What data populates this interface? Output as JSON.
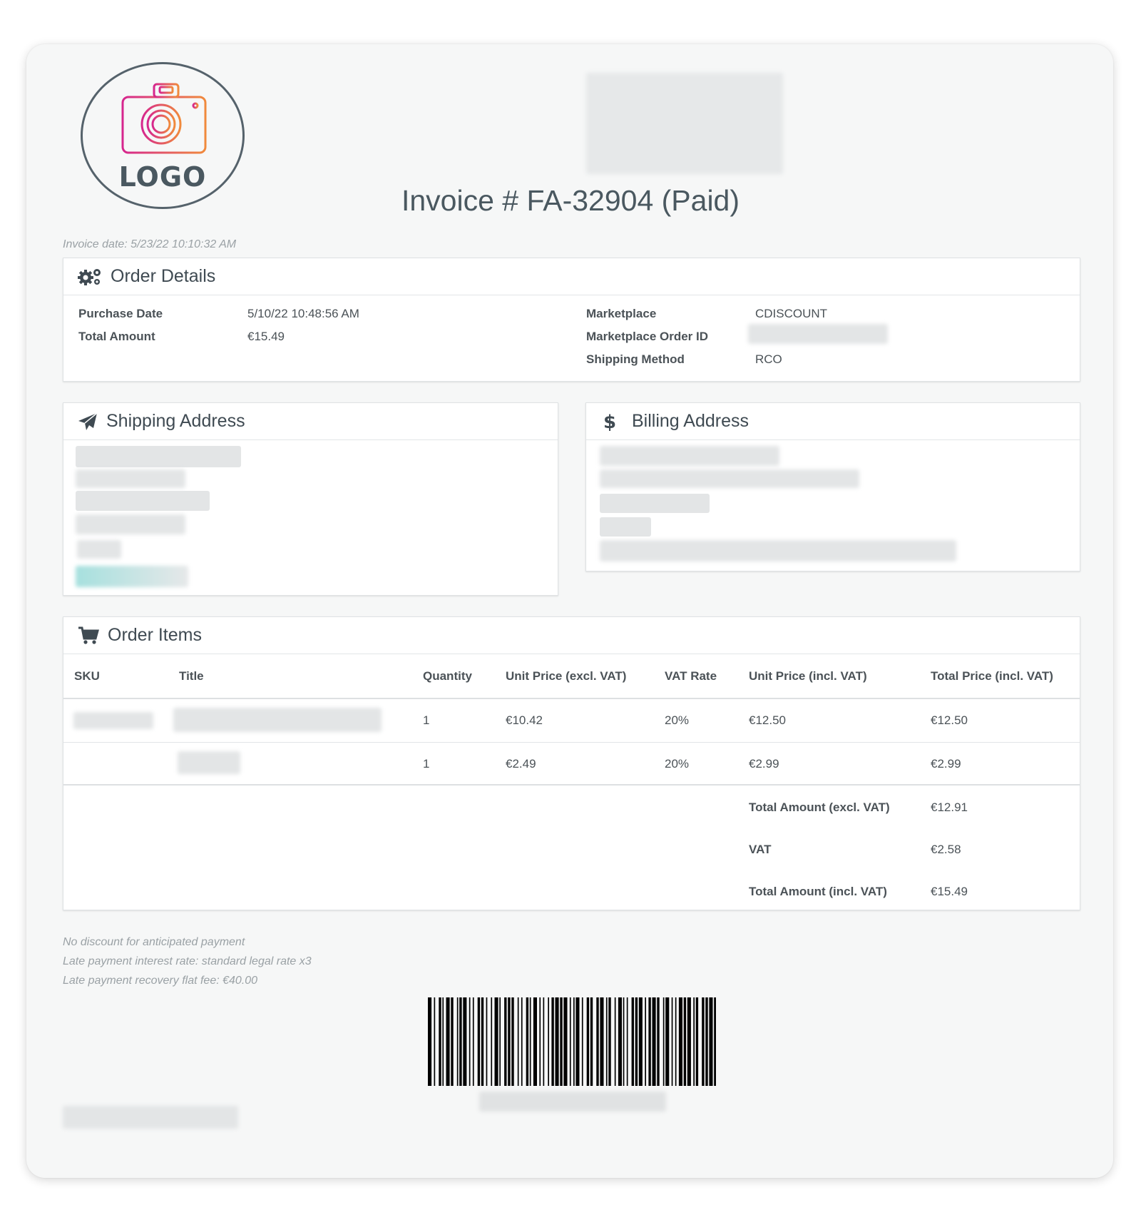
{
  "logo": {
    "text": "LOGO"
  },
  "invoice": {
    "title": "Invoice # FA-32904 (Paid)",
    "date": "Invoice date: 5/23/22 10:10:32 AM"
  },
  "order_details": {
    "heading": "Order Details",
    "purchase_date_label": "Purchase Date",
    "purchase_date": "5/10/22 10:48:56 AM",
    "total_amount_label": "Total Amount",
    "total_amount": "€15.49",
    "marketplace_label": "Marketplace",
    "marketplace": "CDISCOUNT",
    "marketplace_order_id_label": "Marketplace Order ID",
    "shipping_method_label": "Shipping Method",
    "shipping_method": "RCO"
  },
  "shipping": {
    "heading": "Shipping Address"
  },
  "billing": {
    "heading": "Billing Address"
  },
  "order_items": {
    "heading": "Order Items",
    "columns": [
      "SKU",
      "Title",
      "Quantity",
      "Unit Price (excl. VAT)",
      "VAT Rate",
      "Unit Price (incl. VAT)",
      "Total Price (incl. VAT)"
    ],
    "rows": [
      {
        "quantity": "1",
        "unit_excl": "€10.42",
        "vat_rate": "20%",
        "unit_incl": "€12.50",
        "total_incl": "€12.50"
      },
      {
        "quantity": "1",
        "unit_excl": "€2.49",
        "vat_rate": "20%",
        "unit_incl": "€2.99",
        "total_incl": "€2.99"
      }
    ],
    "totals": [
      {
        "label": "Total Amount (excl. VAT)",
        "value": "€12.91"
      },
      {
        "label": "VAT",
        "value": "€2.58"
      },
      {
        "label": "Total Amount (incl. VAT)",
        "value": "€15.49"
      }
    ]
  },
  "footer": {
    "notes": [
      "No discount for anticipated payment",
      "Late payment interest rate: standard legal rate x3",
      "Late payment recovery flat fee: €40.00"
    ]
  },
  "icons": {
    "order_details": "gears-icon",
    "shipping": "paper-plane-icon",
    "billing": "dollar-icon",
    "order_items": "shopping-cart-icon",
    "logo": "camera-icon"
  }
}
